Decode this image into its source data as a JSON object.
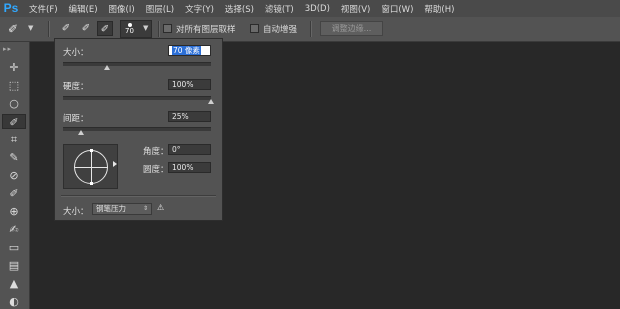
{
  "app": {
    "logo": "Ps",
    "accent": "#31a8ff"
  },
  "menu": {
    "items": [
      "文件(F)",
      "编辑(E)",
      "图像(I)",
      "图层(L)",
      "文字(Y)",
      "选择(S)",
      "滤镜(T)",
      "3D(D)",
      "视图(V)",
      "窗口(W)",
      "帮助(H)"
    ]
  },
  "options": {
    "tool_preset_icon": "brush-icon",
    "brush_size_value": "70",
    "sample_all_layers_label": "对所有图层取样",
    "sample_all_layers_checked": false,
    "auto_enhance_label": "自动增强",
    "auto_enhance_checked": false,
    "refine_edge_label": "调整边缘..."
  },
  "toolbar": {
    "icons": [
      "move-icon",
      "marquee-icon",
      "lasso-icon",
      "quick-selection-icon",
      "crop-icon",
      "eyedropper-icon",
      "spot-healing-icon",
      "brush-icon",
      "clone-stamp-icon",
      "history-brush-icon",
      "eraser-icon",
      "gradient-icon",
      "blur-icon",
      "dodge-icon",
      "pen-icon"
    ],
    "active_tool": "quick-selection-icon"
  },
  "brush_panel": {
    "size_label": "大小：",
    "size_value_highlighted": "70 像素",
    "size_level": 0.3,
    "hardness_label": "硬度：",
    "hardness_value": "100%",
    "hardness_level": 1.0,
    "spacing_label": "间距：",
    "spacing_value": "25%",
    "spacing_level": 0.12,
    "angle_label": "角度：",
    "angle_value": "0°",
    "roundness_label": "圆度：",
    "roundness_value": "100%",
    "control_label": "大小：",
    "control_value": "钢笔压力"
  }
}
